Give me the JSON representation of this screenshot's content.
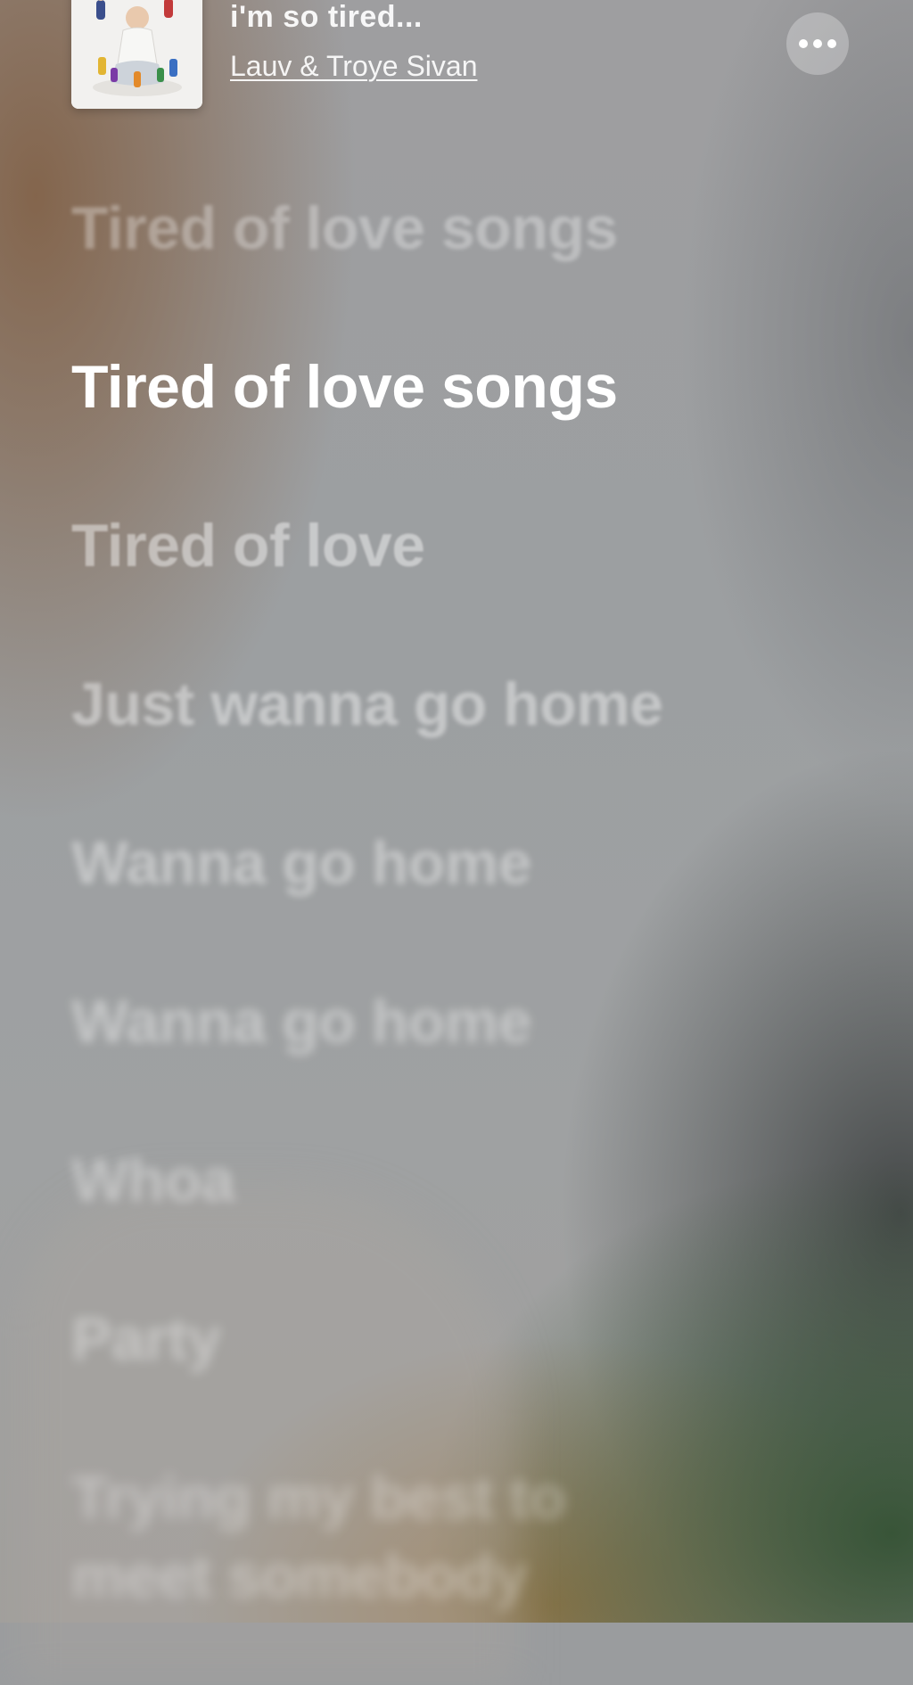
{
  "now_playing": {
    "title": "i'm so tired...",
    "artist": "Lauv & Troye Sivan",
    "more_icon": "ellipsis-icon",
    "album_art_icon": "album-art"
  },
  "lyrics": [
    "Tired of love songs",
    "Tired of love songs",
    "Tired of love",
    "Just wanna go home",
    "Wanna go home",
    "Wanna go home",
    "Whoa",
    "Party",
    "Trying my best to meet somebody"
  ],
  "active_lyric_index": 1,
  "colors": {
    "active_lyric": "#ffffff",
    "background": "#9c9fa1"
  }
}
